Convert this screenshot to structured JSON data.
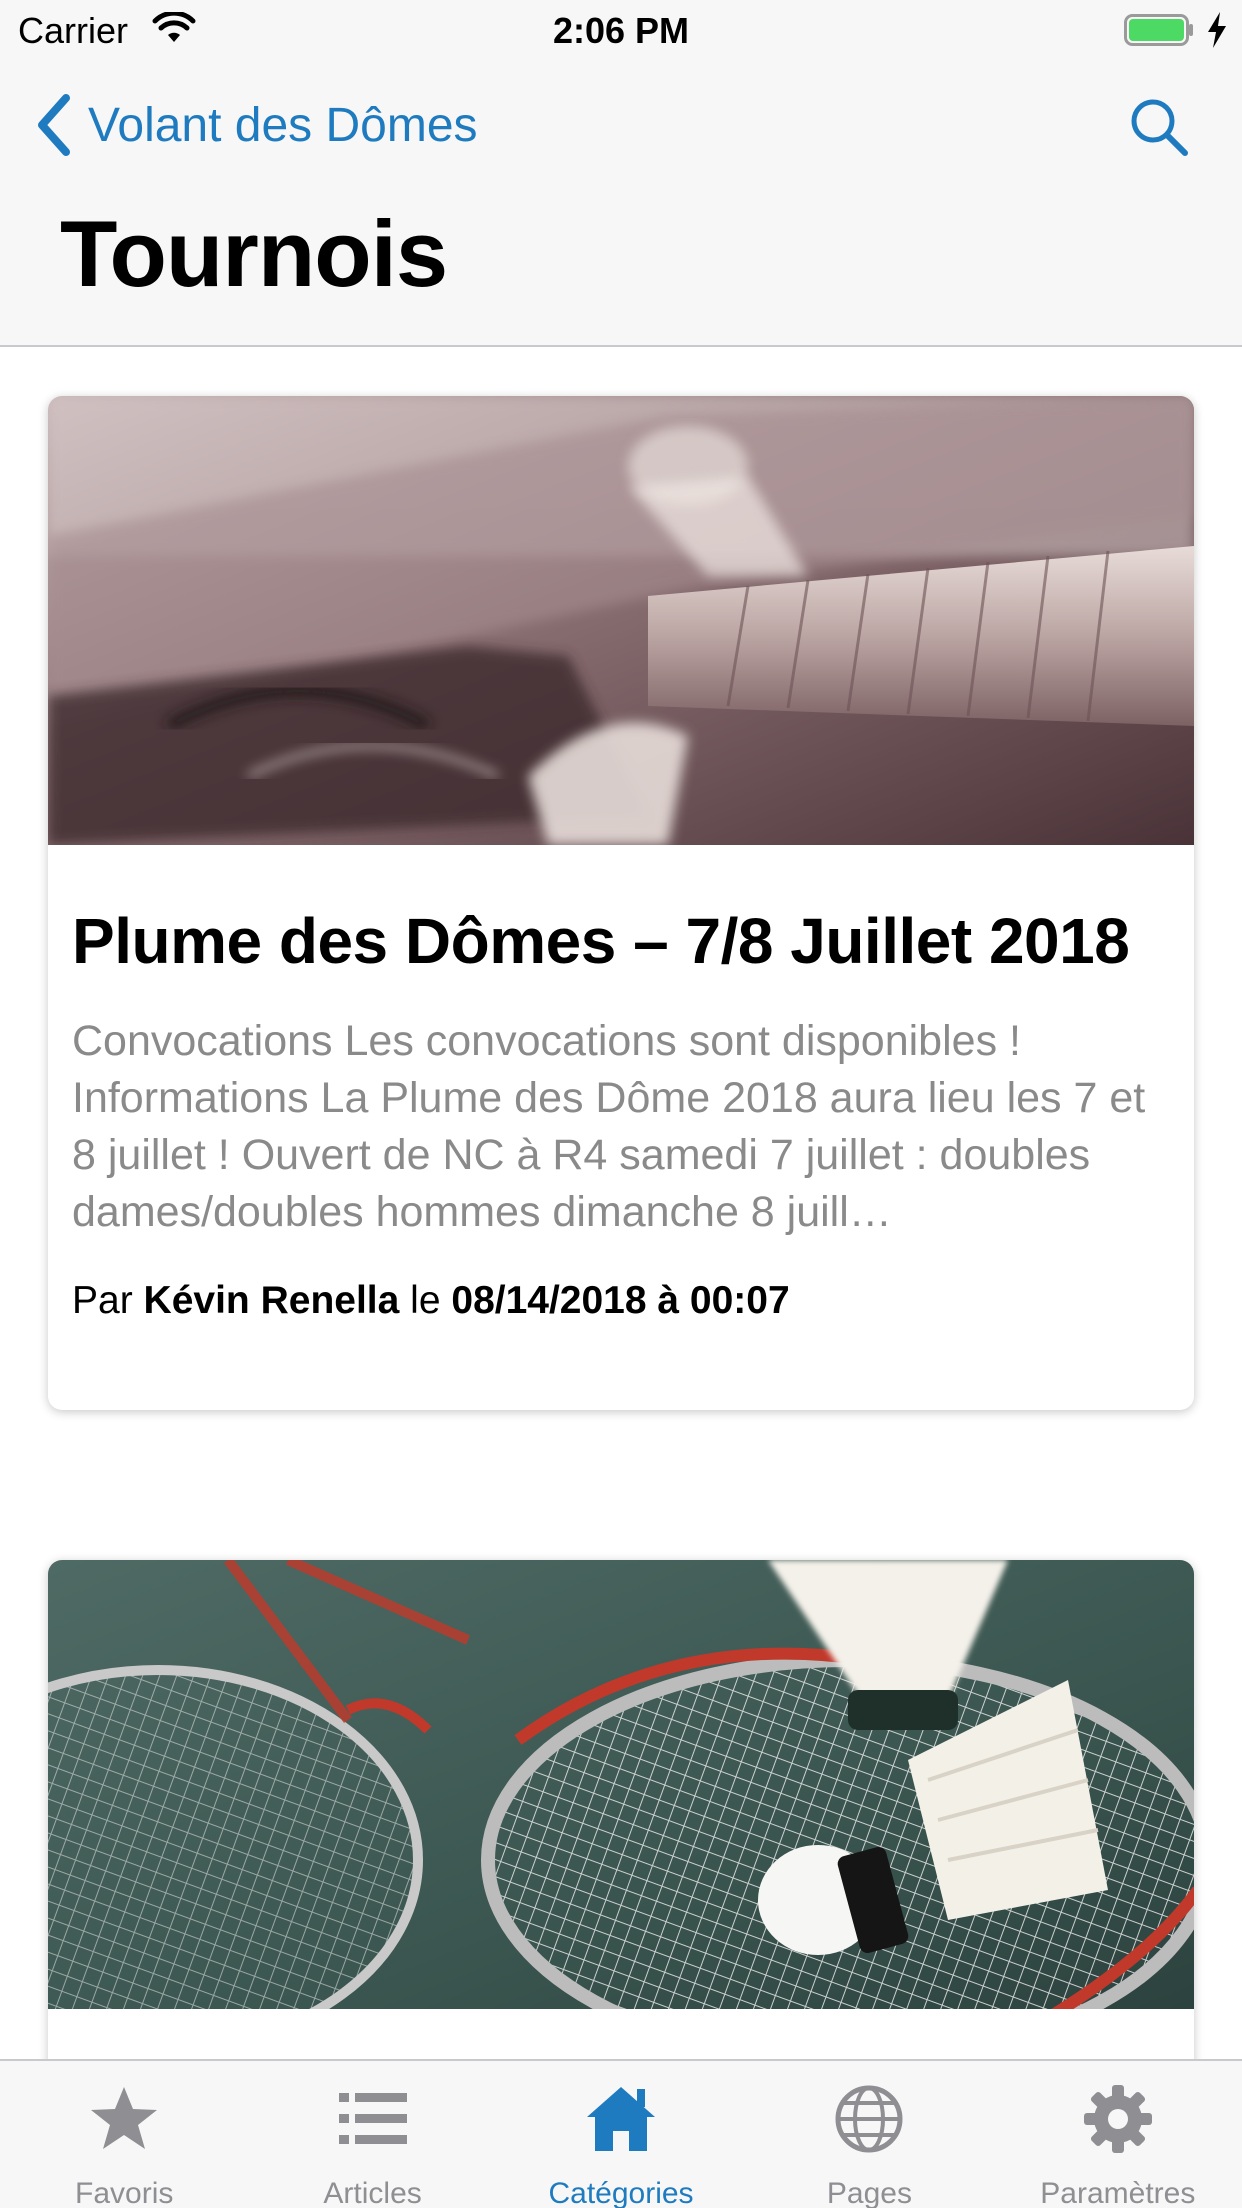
{
  "status_bar": {
    "carrier": "Carrier",
    "time": "2:06 PM"
  },
  "nav": {
    "back_label": "Volant des Dômes",
    "title": "Tournois",
    "back_icon": "chevron-left-icon",
    "search_icon": "search-icon"
  },
  "colors": {
    "accent": "#1f7bbf",
    "inactive": "#8e8e93",
    "battery": "#4cd964"
  },
  "articles": [
    {
      "title": "Plume des Dômes – 7/8 Juillet 2018",
      "excerpt": "Convocations Les convocations sont disponibles ! Informations La Plume des Dôme 2018 aura lieu les 7 et 8 juillet ! Ouvert de NC à R4 samedi 7 juillet : doubles dames/doubles hommes dimanche 8 juill…",
      "meta_prefix": "Par",
      "author": "Kévin Renella",
      "meta_mid": "le",
      "date": "08/14/2018 à 00:07"
    },
    {
      "title": "",
      "excerpt": ""
    }
  ],
  "tabs": [
    {
      "label": "Favoris",
      "icon": "star-icon",
      "active": false
    },
    {
      "label": "Articles",
      "icon": "list-icon",
      "active": false
    },
    {
      "label": "Catégories",
      "icon": "home-icon",
      "active": true
    },
    {
      "label": "Pages",
      "icon": "globe-icon",
      "active": false
    },
    {
      "label": "Paramètres",
      "icon": "gear-icon",
      "active": false
    }
  ]
}
